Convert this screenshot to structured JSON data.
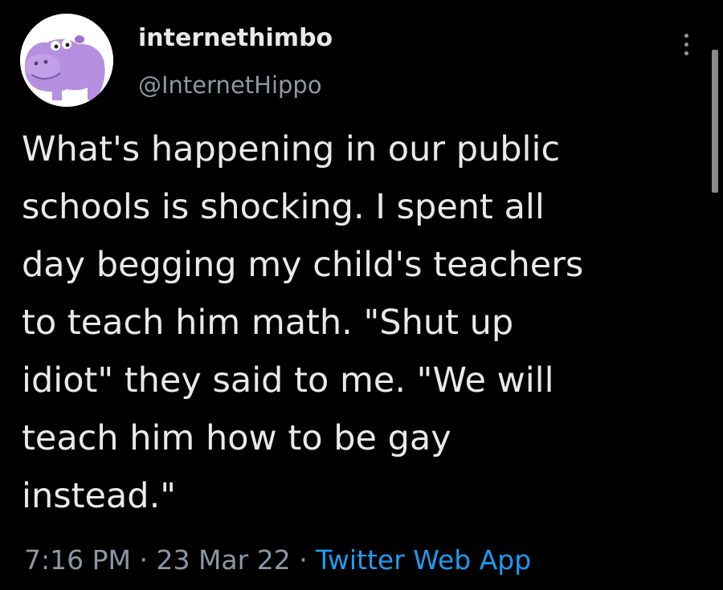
{
  "user": {
    "display_name": "internethimbo",
    "handle": "@InternetHippo",
    "avatar_icon": "hippo-avatar-icon"
  },
  "tweet": {
    "lines": [
      "What's happening in our public",
      "schools is shocking. I spent all",
      "day begging my child's teachers",
      "to teach him math. \"Shut up",
      "idiot\" they said to me. \"We will",
      "teach him how to be gay",
      "instead.\""
    ]
  },
  "meta": {
    "time": "7:16 PM",
    "separator": "·",
    "date": "23 Mar 22",
    "source": "Twitter Web App"
  },
  "icons": {
    "more": "more-options-icon"
  },
  "colors": {
    "background": "#000000",
    "text_primary": "#e7e9ea",
    "text_secondary": "#8b98a5",
    "link": "#1d9bf0",
    "avatar_purple": "#b58fe0"
  }
}
